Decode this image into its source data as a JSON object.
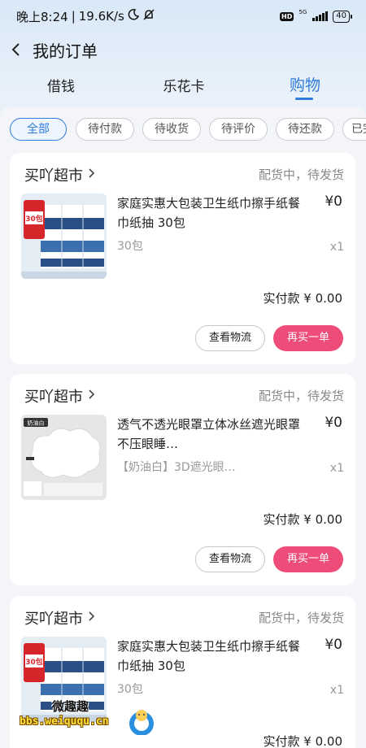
{
  "status_bar": {
    "time": "晚上8:24",
    "separator": "|",
    "speed": "19.6K/s",
    "hd": "HD",
    "network": "5G",
    "battery": "40"
  },
  "nav": {
    "title": "我的订单"
  },
  "main_tabs": [
    {
      "label": "借钱",
      "active": false
    },
    {
      "label": "乐花卡",
      "active": false
    },
    {
      "label": "购物",
      "active": true
    }
  ],
  "filters": [
    {
      "label": "全部",
      "active": true
    },
    {
      "label": "待付款",
      "active": false
    },
    {
      "label": "待收货",
      "active": false
    },
    {
      "label": "待评价",
      "active": false
    },
    {
      "label": "待还款",
      "active": false
    },
    {
      "label": "已完",
      "active": false
    }
  ],
  "orders": [
    {
      "shop": "买吖超市",
      "status": "配货中，待发货",
      "product_title": "家庭实惠大包装卫生纸巾擦手纸餐巾纸抽 30包",
      "price": "¥0",
      "spec": "30包",
      "qty": "x1",
      "paid": "实付款 ¥ 0.00",
      "btn_logistics": "查看物流",
      "btn_rebuy": "再买一单",
      "thumb_text": "30包"
    },
    {
      "shop": "买吖超市",
      "status": "配货中，待发货",
      "product_title": "透气不透光眼罩立体冰丝遮光眼罩 不压眼睡…",
      "price": "¥0",
      "spec": "【奶油白】3D遮光眼…",
      "qty": "x1",
      "paid": "实付款 ¥ 0.00",
      "btn_logistics": "查看物流",
      "btn_rebuy": "再买一单",
      "thumb_text": "奶油白"
    },
    {
      "shop": "买吖超市",
      "status": "配货中，待发货",
      "product_title": "家庭实惠大包装卫生纸巾擦手纸餐巾纸抽 30包",
      "price": "¥0",
      "spec": "30包",
      "qty": "x1",
      "paid": "实付款 ¥ 0.00",
      "thumb_text": "30包"
    }
  ],
  "watermark": {
    "top": "微趣趣",
    "bottom": "bbs.weiququ.cn"
  },
  "colors": {
    "accent": "#2f7bd8",
    "rebuy": "#ee4d7a"
  }
}
